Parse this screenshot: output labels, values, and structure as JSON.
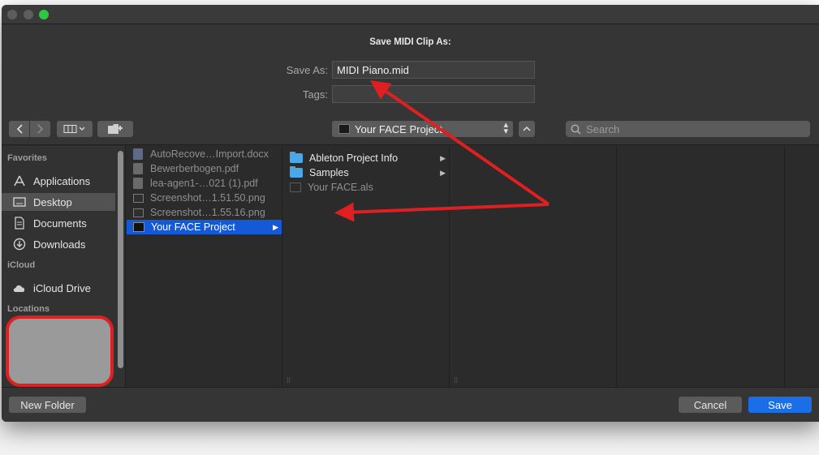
{
  "dialog": {
    "title": "Save MIDI Clip As:",
    "save_as_label": "Save As:",
    "save_as_value": "MIDI Piano.mid",
    "tags_label": "Tags:",
    "tags_value": ""
  },
  "toolbar": {
    "back_icon": "chevron-left-icon",
    "forward_icon": "chevron-right-icon",
    "view_icon": "column-view-icon",
    "location": "Your FACE Project",
    "search_placeholder": "Search"
  },
  "sidebar": {
    "favorites_label": "Favorites",
    "favorites": [
      {
        "label": "Applications",
        "icon": "applications-icon"
      },
      {
        "label": "Desktop",
        "icon": "desktop-icon",
        "selected": true
      },
      {
        "label": "Documents",
        "icon": "documents-icon"
      },
      {
        "label": "Downloads",
        "icon": "downloads-icon"
      }
    ],
    "icloud_label": "iCloud",
    "icloud": [
      {
        "label": "iCloud Drive",
        "icon": "cloud-icon"
      }
    ],
    "locations_label": "Locations"
  },
  "columns": {
    "col1": [
      {
        "label": "AutoRecove…Import.docx",
        "type": "docx"
      },
      {
        "label": "Bewerberbogen.pdf",
        "type": "pdf"
      },
      {
        "label": "lea-agen1-…021 (1).pdf",
        "type": "pdf"
      },
      {
        "label": "Screenshot…1.51.50.png",
        "type": "png"
      },
      {
        "label": "Screenshot…1.55.16.png",
        "type": "png"
      },
      {
        "label": "Your FACE Project",
        "type": "project-folder",
        "selected": true
      }
    ],
    "col2": [
      {
        "label": "Ableton Project Info",
        "type": "folder"
      },
      {
        "label": "Samples",
        "type": "folder"
      },
      {
        "label": "Your FACE.als",
        "type": "als"
      }
    ]
  },
  "footer": {
    "new_folder": "New Folder",
    "cancel": "Cancel",
    "save": "Save"
  },
  "colors": {
    "accent": "#1a6fe8",
    "annotation": "#e02020"
  }
}
